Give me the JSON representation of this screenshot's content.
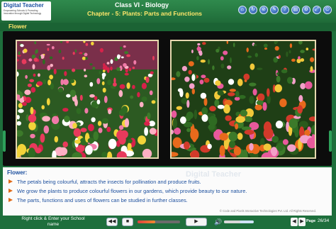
{
  "logo": {
    "name": "Digital Teacher",
    "tagline_1": "Empowering Schools & Promoting",
    "tagline_2": "Innovation through Digital Technology"
  },
  "header": {
    "class_title": "Class VI - Biology",
    "chapter_title": "Chapter - 5: Plants: Parts and Functions",
    "toolbar": [
      {
        "icon": "home-icon",
        "glyph": "⌂"
      },
      {
        "icon": "recycle-icon",
        "glyph": "↻"
      },
      {
        "icon": "no-entry-icon",
        "glyph": "⊘"
      },
      {
        "icon": "pen-icon",
        "glyph": "✎"
      },
      {
        "icon": "help-icon",
        "glyph": "?"
      },
      {
        "icon": "book-icon",
        "glyph": "▤"
      },
      {
        "icon": "settings-icon",
        "glyph": "⚙"
      },
      {
        "icon": "resize-icon",
        "glyph": "⤢"
      },
      {
        "icon": "power-icon",
        "glyph": "⏻"
      }
    ]
  },
  "section": {
    "title": "Flower"
  },
  "images": [
    {
      "name": "tulip-garden-photo"
    },
    {
      "name": "cosmos-garden-photo"
    }
  ],
  "text_panel": {
    "heading": "Flower:",
    "watermark": "Digital Teacher",
    "bullets": [
      "The petals being colourful, attracts the insects for pollination and produce fruits.",
      "We grow the plants to produce colourful flowers in our gardens, which provide beauty to our nature.",
      "The parts, functions and uses of flowers can be studied in further classes."
    ],
    "copyright": "© Code and Pixels Interactive Technologies Pvt. Ltd. All Rights Reserved."
  },
  "footer": {
    "school_line_1": "Right click & Enter your School",
    "school_line_2": "name",
    "prev_glyph": "◀◀",
    "ctrl_glyph": "■",
    "play_glyph": "▶",
    "volume_icon": "🔊",
    "progress": 0.42,
    "volume_level": 0.55,
    "page_label": "Page",
    "page_number": "26/34",
    "nav_left": "◀",
    "nav_right": "▶"
  },
  "colors": {
    "header_green": "#1f6b38",
    "title_yellow": "#ffe66b",
    "text_blue": "#1c4f9e",
    "bullet_orange": "#e06a17"
  }
}
